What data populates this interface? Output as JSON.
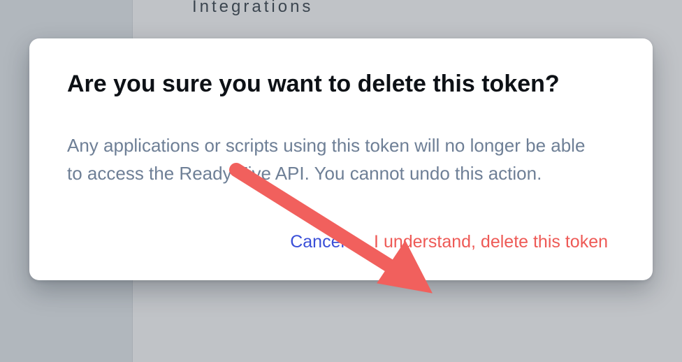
{
  "background": {
    "nav_item": "Integrations"
  },
  "dialog": {
    "title": "Are you sure you want to delete this token?",
    "body": "Any applications or scripts using this token will no longer be able to access the Ready Five API. You cannot undo this action.",
    "cancel_label": "Cancel",
    "confirm_label": "I understand, delete this token"
  },
  "annotation": {
    "arrow_color": "#f1605d"
  }
}
